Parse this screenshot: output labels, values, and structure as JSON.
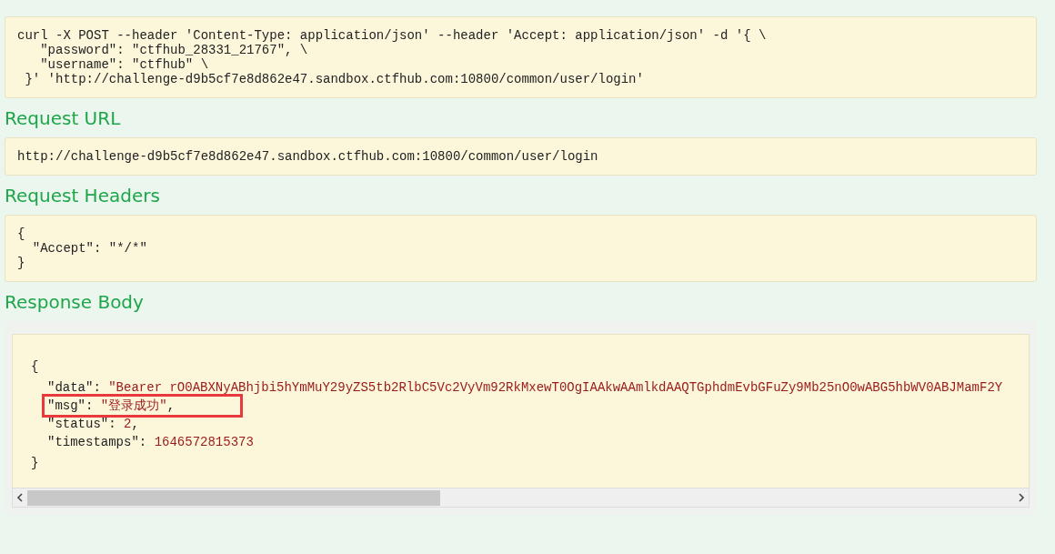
{
  "sections": [
    {
      "kind": "code",
      "lines": [
        "curl -X POST --header 'Content-Type: application/json' --header 'Accept: application/json' -d '{ \\",
        "   \"password\": \"ctfhub_28331_21767\", \\",
        "   \"username\": \"ctfhub\" \\",
        " }' 'http://challenge-d9b5cf7e8d862e47.sandbox.ctfhub.com:10800/common/user/login'"
      ]
    },
    {
      "kind": "code",
      "title": "Request URL",
      "lines": [
        "http://challenge-d9b5cf7e8d862e47.sandbox.ctfhub.com:10800/common/user/login"
      ]
    },
    {
      "kind": "code",
      "title": "Request Headers",
      "lines": [
        "{",
        "  \"Accept\": \"*/*\"",
        "}"
      ]
    },
    {
      "kind": "response",
      "title": "Response Body",
      "open": "{",
      "close": "}",
      "fields": [
        {
          "key": "\"data\":",
          "value": "\"Bearer rO0ABXNyABhjbi5hYmMuY29yZS5tb2RlbC5Vc2VyVm92RkMxewT0OgIAAkwAAmlkdAAQTGphdmEvbGFuZy9Mb25nO0wABG5hbWV0ABJMamF2Y",
          "highlighted": false
        },
        {
          "key": "\"msg\":",
          "value": "\"登录成功\"",
          "sep": ",",
          "highlighted": true
        },
        {
          "key": "\"status\":",
          "value": "2",
          "sep": ",",
          "highlighted": false
        },
        {
          "key": "\"timestamps\":",
          "value": "1646572815373",
          "highlighted": false
        }
      ]
    }
  ]
}
